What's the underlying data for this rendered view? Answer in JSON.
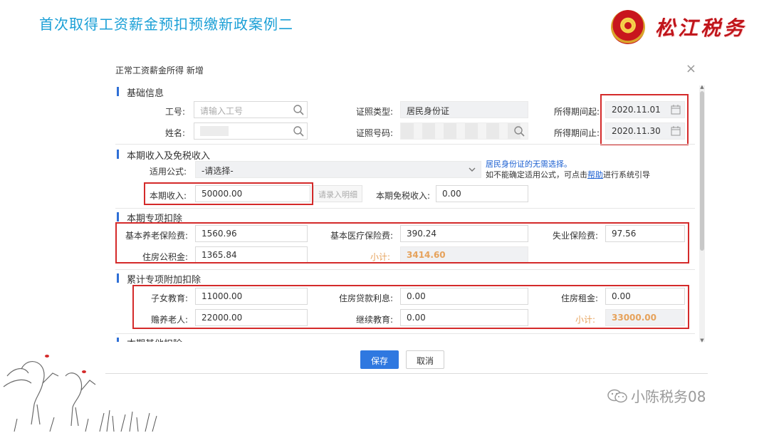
{
  "slide": {
    "title": "首次取得工资薪金预扣预缴新政案例二"
  },
  "logo": {
    "brand": "松江税务"
  },
  "watermark": {
    "text": "小陈税务08"
  },
  "dialog": {
    "title": "正常工资薪金所得 新增",
    "close_icon": "×",
    "sections": {
      "basic": "基础信息",
      "income": "本期收入及免税收入",
      "special": "本期专项扣除",
      "cumulative": "累计专项附加扣除",
      "other": "本期其他扣除"
    },
    "basic": {
      "job_no_label": "工号:",
      "job_no_placeholder": "请输入工号",
      "name_label": "姓名:",
      "id_type_label": "证照类型:",
      "id_type_value": "居民身份证",
      "id_no_label": "证照号码:",
      "period_start_label": "所得期间起:",
      "period_start_value": "2020.11.01",
      "period_end_label": "所得期间止:",
      "period_end_value": "2020.11.30"
    },
    "income": {
      "formula_label": "适用公式:",
      "formula_value": "-请选择-",
      "note_line1": "居民身份证的无需选择。",
      "note_line2_pre": "如不能确定适用公式，可点击",
      "note_line2_link": "帮助",
      "note_line2_post": "进行系统引导",
      "current_income_label": "本期收入:",
      "current_income_value": "50000.00",
      "detail_button": "请录入明细",
      "tax_free_label": "本期免税收入:",
      "tax_free_value": "0.00"
    },
    "special": {
      "pension_label": "基本养老保险费:",
      "pension_value": "1560.96",
      "medical_label": "基本医疗保险费:",
      "medical_value": "390.24",
      "unemployment_label": "失业保险费:",
      "unemployment_value": "97.56",
      "housing_fund_label": "住房公积金:",
      "housing_fund_value": "1365.84",
      "subtotal_label": "小计:",
      "subtotal_value": "3414.60"
    },
    "cumulative": {
      "children_label": "子女教育:",
      "children_value": "11000.00",
      "mortgage_label": "住房贷款利息:",
      "mortgage_value": "0.00",
      "rent_label": "住房租金:",
      "rent_value": "0.00",
      "elderly_label": "赡养老人:",
      "elderly_value": "22000.00",
      "continuing_label": "继续教育:",
      "continuing_value": "0.00",
      "subtotal_label": "小计:",
      "subtotal_value": "33000.00"
    },
    "buttons": {
      "save": "保存",
      "cancel": "取消"
    }
  },
  "colors": {
    "title_blue": "#1a9fd6",
    "highlight_red": "#d42a2a",
    "primary_blue": "#2f78e0",
    "subtotal_orange": "#e6a25b"
  },
  "icons": [
    "search-icon",
    "calendar-icon",
    "chevron-down-icon",
    "close-icon",
    "wechat-icon"
  ]
}
